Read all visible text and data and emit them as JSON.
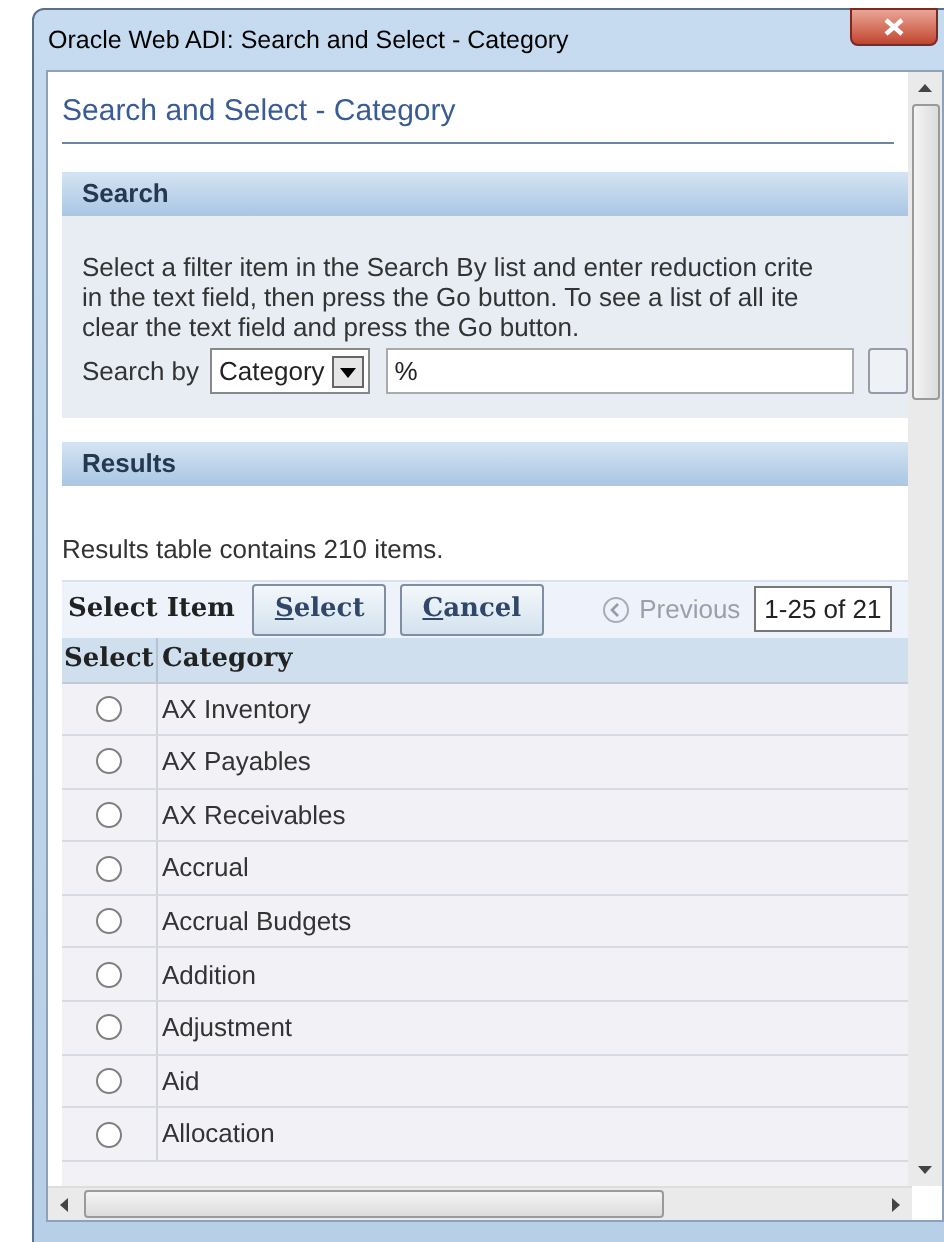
{
  "window": {
    "title": "Oracle Web ADI: Search and Select - Category"
  },
  "page_title": "Search and Select - Category",
  "search": {
    "heading": "Search",
    "instructions": [
      "Select a filter item in the Search By list and enter reduction crite",
      "in the text field, then press the Go button. To see a list of all ite",
      "clear the text field and press the Go button."
    ],
    "search_by_label": "Search by",
    "search_by_value": "Category",
    "criteria_value": "%"
  },
  "results": {
    "heading": "Results",
    "summary": "Results table contains 210 items.",
    "toolbar_label": "Select Item",
    "buttons": [
      {
        "label": "Select",
        "first_letter_underlined": true
      },
      {
        "label": "Cancel",
        "first_letter_underlined": true
      }
    ],
    "previous": "Previous",
    "range": "1-25 of 21",
    "columns": [
      "Select",
      "Category"
    ],
    "rows": [
      {
        "category": "AX Inventory",
        "selected": false
      },
      {
        "category": "AX Payables",
        "selected": false
      },
      {
        "category": "AX Receivables",
        "selected": false
      },
      {
        "category": "Accrual",
        "selected": false
      },
      {
        "category": "Accrual Budgets",
        "selected": false
      },
      {
        "category": "Addition",
        "selected": false
      },
      {
        "category": "Adjustment",
        "selected": false
      },
      {
        "category": "Aid",
        "selected": false
      },
      {
        "category": "Allocation",
        "selected": false
      }
    ]
  }
}
